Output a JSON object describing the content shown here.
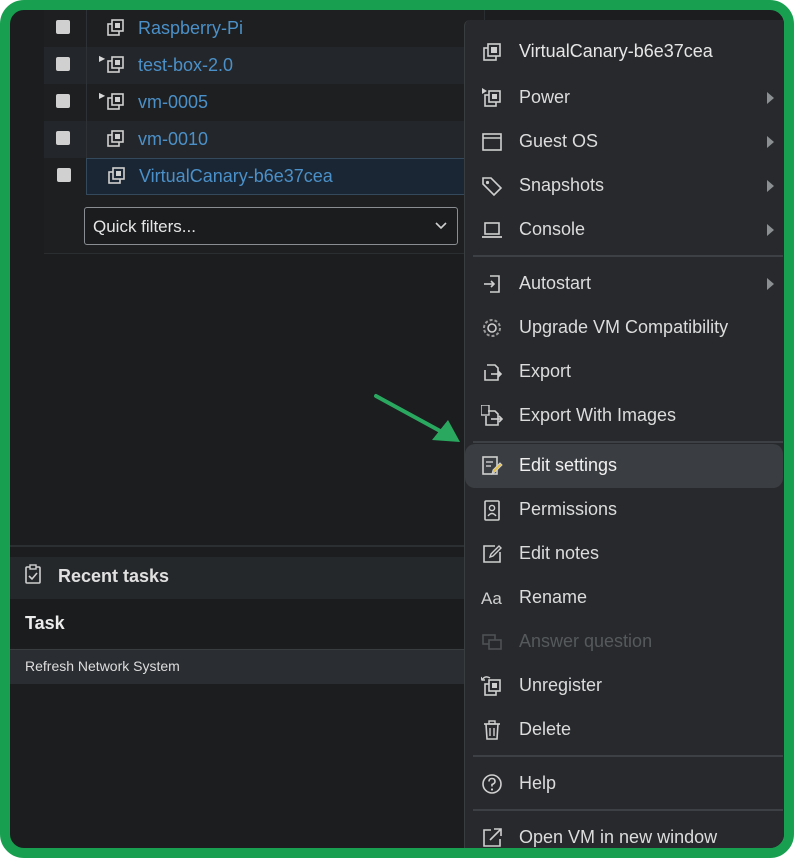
{
  "vm_list": {
    "rows": [
      {
        "name": "Raspberry-Pi",
        "expandable": false
      },
      {
        "name": "test-box-2.0",
        "expandable": true
      },
      {
        "name": "vm-0005",
        "expandable": true
      },
      {
        "name": "vm-0010",
        "expandable": false
      },
      {
        "name": "VirtualCanary-b6e37cea",
        "expandable": false,
        "selected": true
      }
    ],
    "quick_filter_placeholder": "Quick filters..."
  },
  "recent_tasks": {
    "title": "Recent tasks",
    "column_task": "Task",
    "rows": [
      "Refresh Network System"
    ]
  },
  "context_menu": {
    "header": "VirtualCanary-b6e37cea",
    "items": {
      "power": "Power",
      "guest_os": "Guest OS",
      "snapshots": "Snapshots",
      "console": "Console",
      "autostart": "Autostart",
      "upgrade": "Upgrade VM Compatibility",
      "export": "Export",
      "export_images": "Export With Images",
      "edit_settings": "Edit settings",
      "permissions": "Permissions",
      "edit_notes": "Edit notes",
      "rename": "Rename",
      "answer_question": "Answer question",
      "unregister": "Unregister",
      "delete": "Delete",
      "help": "Help",
      "open_new_window": "Open VM in new window"
    },
    "rename_icon_text": "Aa"
  },
  "colors": {
    "frame_border": "#18a050",
    "vm_link": "#4b90c8",
    "arrow": "#2aa860"
  }
}
